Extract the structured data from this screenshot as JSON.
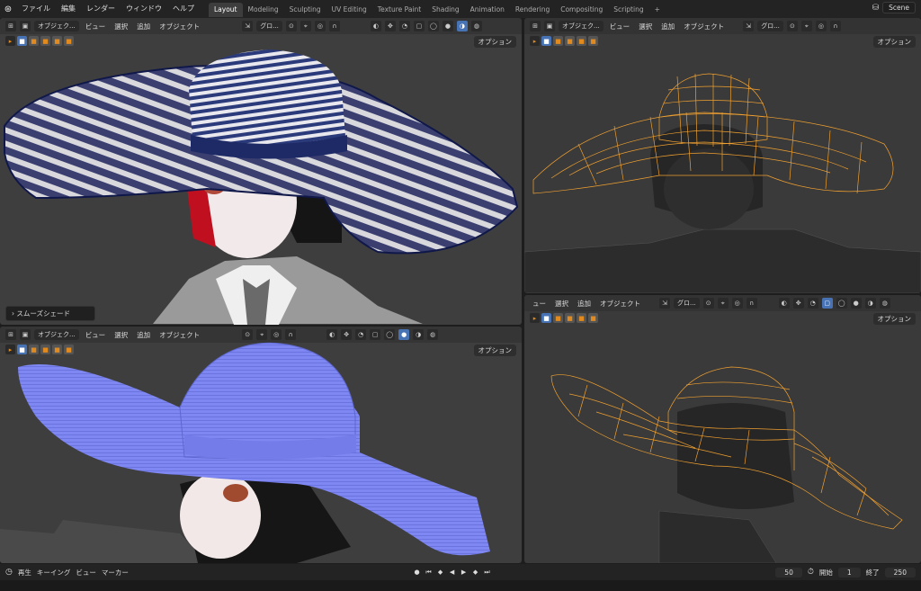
{
  "topbar": {
    "menu": [
      "ファイル",
      "編集",
      "レンダー",
      "ウィンドウ",
      "ヘルプ"
    ],
    "workspaces": [
      "Layout",
      "Modeling",
      "Sculpting",
      "UV Editing",
      "Texture Paint",
      "Shading",
      "Animation",
      "Rendering",
      "Compositing",
      "Scripting"
    ],
    "active_workspace": "Layout",
    "add_tab": "+",
    "scene": "Scene"
  },
  "viewport_header": {
    "mode": "オブジェク...",
    "view": "ビュー",
    "select": "選択",
    "add": "追加",
    "object": "オブジェクト",
    "orientation": "グロ...",
    "options": "オプション"
  },
  "viewport_header_br": {
    "view": "ュー",
    "select": "選択",
    "add": "追加",
    "object": "オブジェクト",
    "orientation": "グロ..."
  },
  "viewports": {
    "tl_overlay": "スムーズシェード"
  },
  "timeline": {
    "playback": "再生",
    "keying": "キーイング",
    "view": "ビュー",
    "marker": "マーカー",
    "current_frame": "50",
    "start_label": "開始",
    "start": "1",
    "end_label": "終了",
    "end": "250"
  },
  "colors": {
    "accent": "#4772b3",
    "wire": "#f0a030",
    "hat_blue": "#7f88f2"
  }
}
